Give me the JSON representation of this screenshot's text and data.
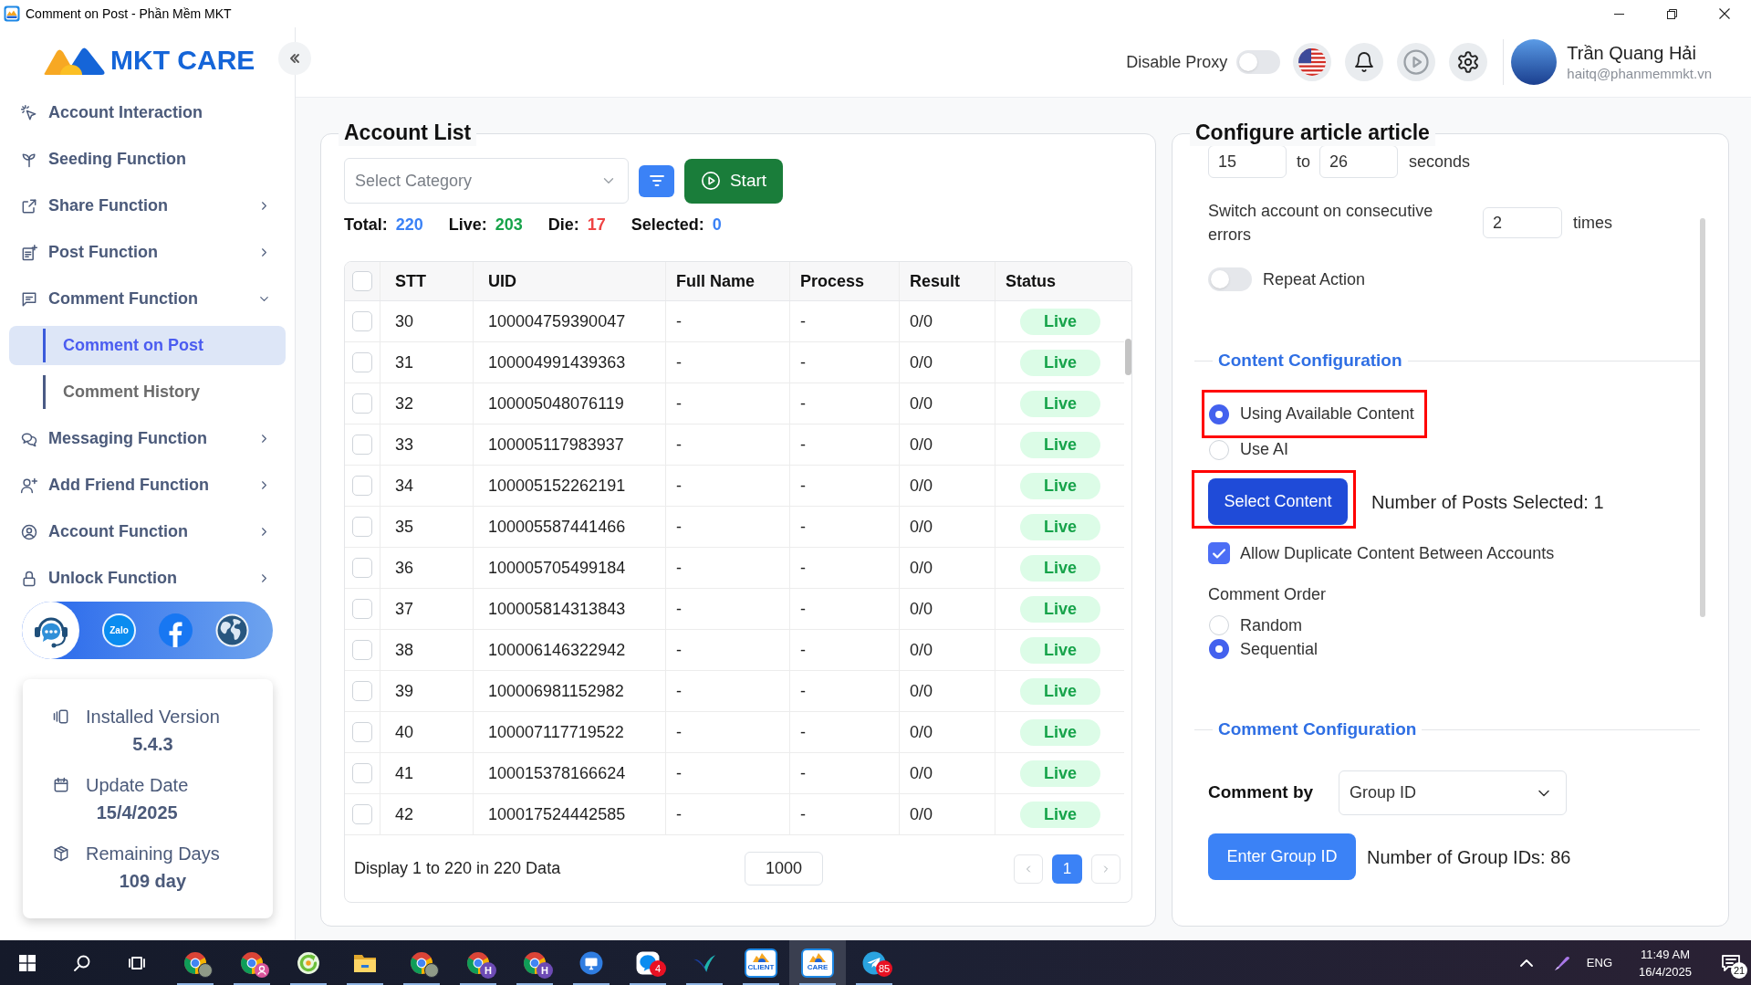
{
  "window": {
    "title": "Comment on Post - Phần Mềm MKT"
  },
  "sidebar": {
    "logo": "MKT CARE",
    "items": [
      {
        "label": "Account Interaction",
        "kind": "link",
        "selected": false
      },
      {
        "label": "Seeding Function",
        "kind": "link",
        "selected": false
      },
      {
        "label": "Share Function",
        "kind": "group",
        "expanded": false,
        "selected": false
      },
      {
        "label": "Post Function",
        "kind": "group",
        "expanded": false,
        "selected": false
      },
      {
        "label": "Comment Function",
        "kind": "group",
        "expanded": true,
        "selected": false,
        "children": [
          {
            "label": "Comment on Post",
            "selected": true
          },
          {
            "label": "Comment History",
            "selected": false
          }
        ]
      },
      {
        "label": "Messaging Function",
        "kind": "group",
        "expanded": false,
        "selected": false
      },
      {
        "label": "Add Friend Function",
        "kind": "group",
        "expanded": false,
        "selected": false
      },
      {
        "label": "Account Function",
        "kind": "group",
        "expanded": false,
        "selected": false
      },
      {
        "label": "Unlock Function",
        "kind": "group",
        "expanded": false,
        "selected": false
      }
    ],
    "social": [
      {
        "kind": "support"
      },
      {
        "kind": "zalo",
        "text": "Zalo"
      },
      {
        "kind": "facebook"
      },
      {
        "kind": "web"
      }
    ],
    "info": [
      {
        "label": "Installed Version",
        "value": "5.4.3"
      },
      {
        "label": "Update Date",
        "value": "15/4/2025"
      },
      {
        "label": "Remaining Days",
        "value": "109 day"
      }
    ]
  },
  "header": {
    "proxy": {
      "label": "Disable Proxy",
      "on": false
    },
    "user": {
      "name": "Trần Quang Hải",
      "email": "haitq@phanmemmkt.vn"
    }
  },
  "account_list": {
    "title": "Account List",
    "category": {
      "placeholder": "Select Category"
    },
    "start": "Start",
    "stats": [
      {
        "label": "Total:",
        "value": "220",
        "color": "#3b82f6"
      },
      {
        "label": "Live:",
        "value": "203",
        "color": "#16a34a"
      },
      {
        "label": "Die:",
        "value": "17",
        "color": "#ef4444"
      },
      {
        "label": "Selected:",
        "value": "0",
        "color": "#3b82f6"
      }
    ],
    "table": {
      "columns": [
        "STT",
        "UID",
        "Full Name",
        "Process",
        "Result",
        "Status"
      ],
      "all_checked": false,
      "rows": [
        {
          "stt": "30",
          "uid": "100004759390047",
          "full_name": "-",
          "process": "-",
          "result": "0/0",
          "status": "Live",
          "checked": false
        },
        {
          "stt": "31",
          "uid": "100004991439363",
          "full_name": "-",
          "process": "-",
          "result": "0/0",
          "status": "Live",
          "checked": false
        },
        {
          "stt": "32",
          "uid": "100005048076119",
          "full_name": "-",
          "process": "-",
          "result": "0/0",
          "status": "Live",
          "checked": false
        },
        {
          "stt": "33",
          "uid": "100005117983937",
          "full_name": "-",
          "process": "-",
          "result": "0/0",
          "status": "Live",
          "checked": false
        },
        {
          "stt": "34",
          "uid": "100005152262191",
          "full_name": "-",
          "process": "-",
          "result": "0/0",
          "status": "Live",
          "checked": false
        },
        {
          "stt": "35",
          "uid": "100005587441466",
          "full_name": "-",
          "process": "-",
          "result": "0/0",
          "status": "Live",
          "checked": false
        },
        {
          "stt": "36",
          "uid": "100005705499184",
          "full_name": "-",
          "process": "-",
          "result": "0/0",
          "status": "Live",
          "checked": false
        },
        {
          "stt": "37",
          "uid": "100005814313843",
          "full_name": "-",
          "process": "-",
          "result": "0/0",
          "status": "Live",
          "checked": false
        },
        {
          "stt": "38",
          "uid": "100006146322942",
          "full_name": "-",
          "process": "-",
          "result": "0/0",
          "status": "Live",
          "checked": false
        },
        {
          "stt": "39",
          "uid": "100006981152982",
          "full_name": "-",
          "process": "-",
          "result": "0/0",
          "status": "Live",
          "checked": false
        },
        {
          "stt": "40",
          "uid": "100007117719522",
          "full_name": "-",
          "process": "-",
          "result": "0/0",
          "status": "Live",
          "checked": false
        },
        {
          "stt": "41",
          "uid": "100015378166624",
          "full_name": "-",
          "process": "-",
          "result": "0/0",
          "status": "Live",
          "checked": false
        },
        {
          "stt": "42",
          "uid": "100017524442585",
          "full_name": "-",
          "process": "-",
          "result": "0/0",
          "status": "Live",
          "checked": false
        }
      ]
    },
    "footer": {
      "summary": "Display 1 to 220 in 220 Data",
      "page_size": "1000",
      "pages": [
        {
          "label": "1",
          "selected": true
        }
      ]
    }
  },
  "config": {
    "title": "Configure article article",
    "delay": {
      "from": "15",
      "separator": "to",
      "to": "26",
      "unit": "seconds"
    },
    "error_switch": {
      "label": "Switch account on consecutive errors",
      "value": "2",
      "unit": "times"
    },
    "repeat": {
      "label": "Repeat Action",
      "on": false
    },
    "content": {
      "title": "Content Configuration",
      "options": [
        {
          "label": "Using Available Content",
          "selected": true,
          "highlighted": true
        },
        {
          "label": "Use AI",
          "selected": false,
          "highlighted": false
        }
      ],
      "select_button": {
        "label": "Select Content",
        "highlighted": true
      },
      "posts_selected": "Number of Posts Selected: 1",
      "allow_duplicate": {
        "label": "Allow Duplicate Content Between Accounts",
        "checked": true
      },
      "order_label": "Comment Order",
      "order_options": [
        {
          "label": "Random",
          "selected": false
        },
        {
          "label": "Sequential",
          "selected": true
        }
      ]
    },
    "comment": {
      "title": "Comment Configuration",
      "by_label": "Comment by",
      "by_value": "Group ID",
      "button": "Enter Group ID",
      "group_count": "Number of Group IDs: 86"
    }
  },
  "taskbar": {
    "apps": [
      {
        "kind": "browser",
        "running": true,
        "active": false,
        "profile": {
          "kind": "photo"
        }
      },
      {
        "kind": "browser",
        "running": true,
        "active": false,
        "profile": {
          "kind": "person"
        }
      },
      {
        "kind": "circular",
        "running": true,
        "active": false
      },
      {
        "kind": "folder",
        "running": true,
        "active": false
      },
      {
        "kind": "browser",
        "running": true,
        "active": false,
        "profile": {
          "kind": "photo"
        }
      },
      {
        "kind": "browser",
        "running": true,
        "active": false,
        "profile": {
          "kind": "letter",
          "text": "H"
        }
      },
      {
        "kind": "browser",
        "running": true,
        "active": false,
        "profile": {
          "kind": "letter",
          "text": "H"
        }
      },
      {
        "kind": "monitor",
        "running": true,
        "active": false
      },
      {
        "kind": "chat",
        "running": true,
        "active": false,
        "badge": "4"
      },
      {
        "kind": "swoosh",
        "running": true,
        "active": false
      },
      {
        "kind": "tile",
        "running": true,
        "active": false,
        "tile_text": "CLIENT"
      },
      {
        "kind": "tile",
        "running": true,
        "active": true,
        "tile_text": "CARE"
      },
      {
        "kind": "plane",
        "running": true,
        "active": false,
        "badge": "85"
      }
    ],
    "tray": {
      "language": "ENG",
      "time": "11:49 AM",
      "date": "16/4/2025",
      "notifications": "21"
    }
  }
}
